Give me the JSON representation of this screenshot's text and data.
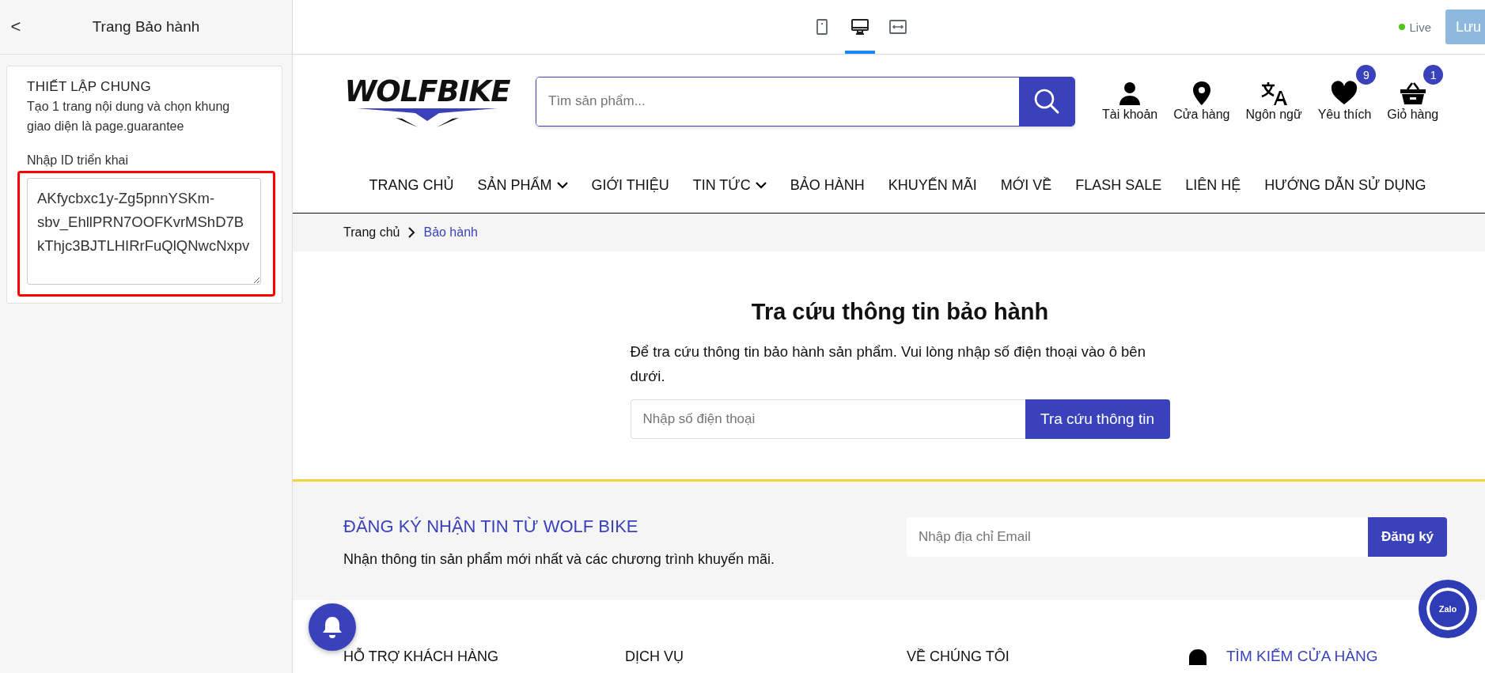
{
  "sidebar": {
    "back": "<",
    "title": "Trang Bảo hành",
    "card": {
      "heading": "THIẾT LẬP CHUNG",
      "description": "Tạo 1 trang nội dung và chọn khung giao diện là page.guarantee",
      "field_label": "Nhập ID triển khai",
      "value": "AKfycbxc1y-Zg5pnnYSKm-sbv_EhllPRN7OOFKvrMShD7BkThjc3BJTLHIRrFuQlQNwcNxpv",
      "highlighted": true
    }
  },
  "toolbar": {
    "devices": [
      {
        "kind": "tablet",
        "selected": false
      },
      {
        "kind": "desktop",
        "selected": true
      },
      {
        "kind": "fullwidth",
        "selected": false
      }
    ],
    "status": "Live",
    "save": "Lưu"
  },
  "site": {
    "logo": "WOLFBIKE",
    "search_placeholder": "Tìm sản phẩm...",
    "header_icons": [
      {
        "kind": "account",
        "label": "Tài khoản"
      },
      {
        "kind": "store",
        "label": "Cửa hàng"
      },
      {
        "kind": "language",
        "label": "Ngôn ngữ"
      },
      {
        "kind": "wishlist",
        "label": "Yêu thích",
        "badge": "9"
      },
      {
        "kind": "cart",
        "label": "Giỏ hàng",
        "badge": "1"
      }
    ],
    "nav": [
      {
        "label": "TRANG CHỦ",
        "dropdown": false
      },
      {
        "label": "SẢN PHẨM",
        "dropdown": true
      },
      {
        "label": "GIỚI THIỆU",
        "dropdown": false
      },
      {
        "label": "TIN TỨC",
        "dropdown": true
      },
      {
        "label": "BẢO HÀNH",
        "dropdown": false
      },
      {
        "label": "KHUYẾN MÃI",
        "dropdown": false
      },
      {
        "label": "MỚI VỀ",
        "dropdown": false
      },
      {
        "label": "FLASH SALE",
        "dropdown": false
      },
      {
        "label": "LIÊN HỆ",
        "dropdown": false
      },
      {
        "label": "HƯỚNG DẪN SỬ DỤNG",
        "dropdown": false
      }
    ],
    "breadcrumb": [
      {
        "label": "Trang chủ",
        "current": false
      },
      {
        "label": "Bảo hành",
        "current": true
      }
    ],
    "lookup": {
      "title": "Tra cứu thông tin bảo hành",
      "description": "Để tra cứu thông tin bảo hành sản phẩm. Vui lòng nhập số điện thoại vào ô bên dưới.",
      "placeholder": "Nhập số điện thoại",
      "button": "Tra cứu thông tin"
    },
    "newsletter": {
      "title": "ĐĂNG KÝ NHẬN TIN TỪ WOLF BIKE",
      "description": "Nhận thông tin sản phẩm mới nhất và các chương trình khuyến mãi.",
      "placeholder": "Nhập địa chỉ Email",
      "button": "Đăng ký"
    },
    "footer_columns": [
      {
        "kind": "plain",
        "heading": "HỖ TRỢ KHÁCH HÀNG"
      },
      {
        "kind": "plain",
        "heading": "DỊCH VỤ"
      },
      {
        "kind": "plain",
        "heading": "VỀ CHÚNG TÔI"
      },
      {
        "kind": "store",
        "heading": "TÌM KIẾM CỬA HÀNG"
      }
    ],
    "chat_button": "Zalo"
  }
}
